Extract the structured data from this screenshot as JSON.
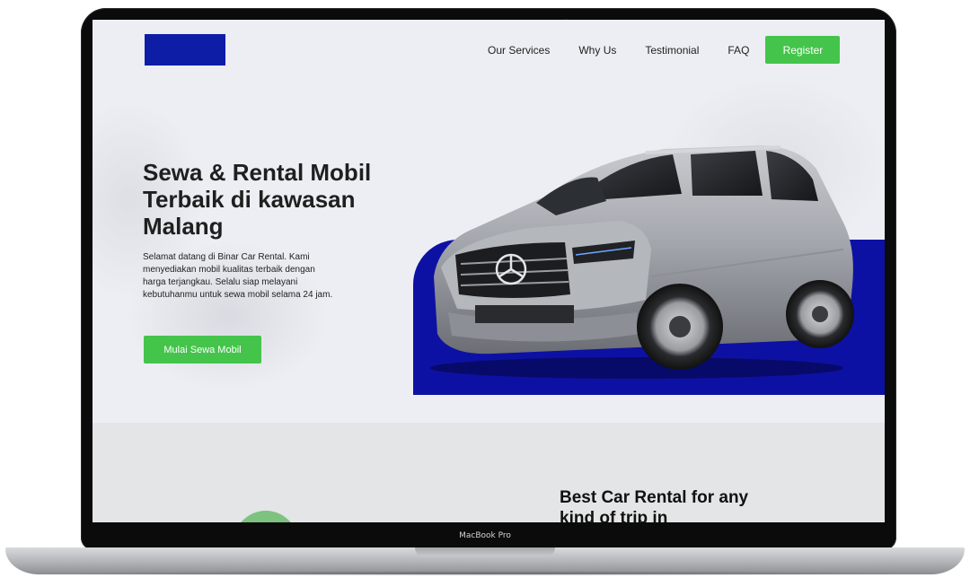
{
  "device": {
    "label": "MacBook Pro"
  },
  "site": {
    "nav": {
      "links": [
        "Our Services",
        "Why Us",
        "Testimonial",
        "FAQ"
      ],
      "register_label": "Register"
    },
    "hero": {
      "title": "Sewa & Rental Mobil Terbaik di kawasan Malang",
      "description": "Selamat datang di Binar Car Rental. Kami menyediakan mobil kualitas terbaik dengan harga terjangkau. Selalu siap melayani kebutuhanmu untuk sewa mobil selama 24 jam.",
      "cta_label": "Mulai Sewa Mobil"
    },
    "section2": {
      "title": "Best Car Rental for any kind of trip in"
    },
    "colors": {
      "brand_blue": "#0d1da6",
      "accent_green": "#44c44b"
    }
  }
}
